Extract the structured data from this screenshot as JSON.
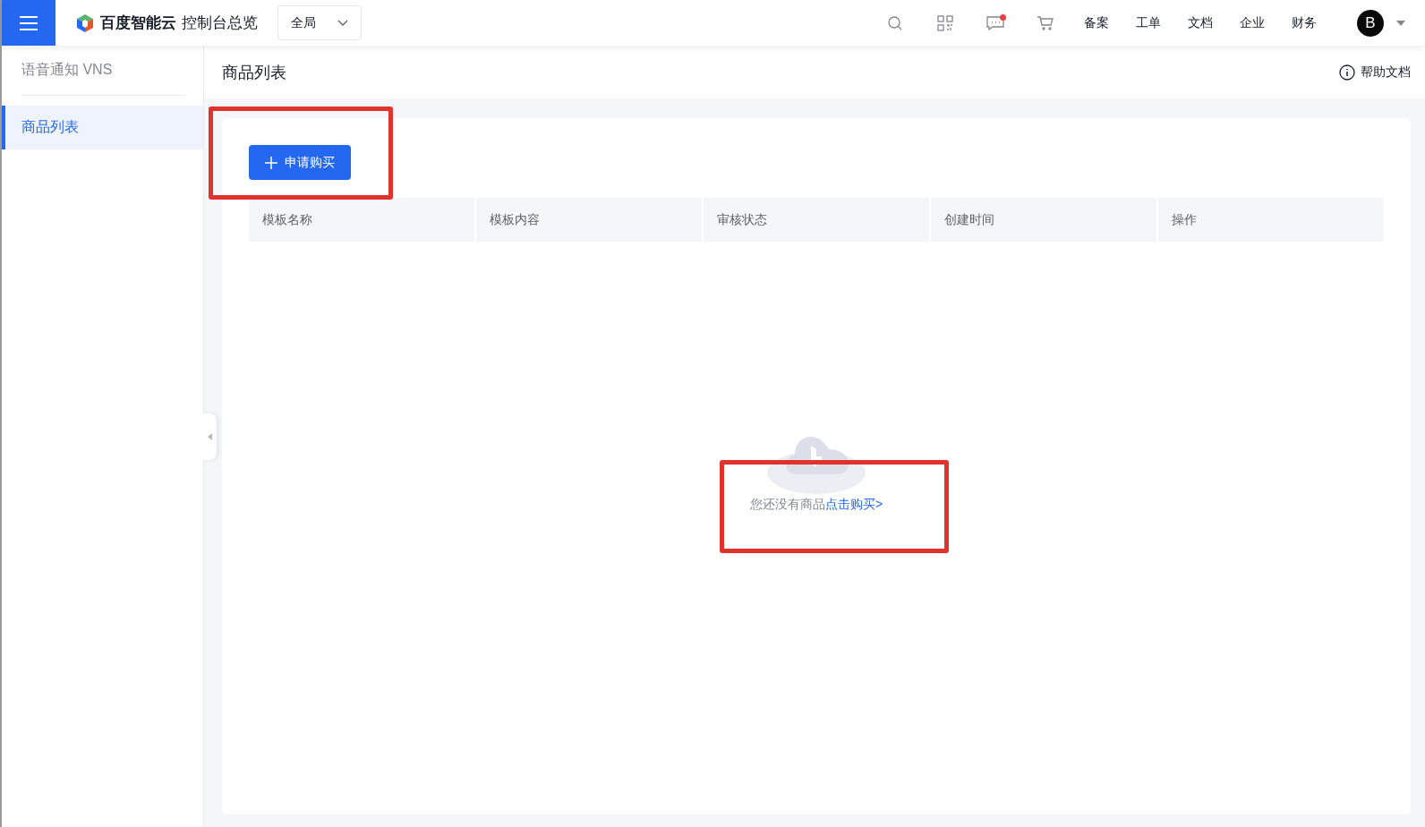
{
  "topbar": {
    "brand": "百度智能云",
    "console": "控制台总览",
    "region": "全局",
    "icons": [
      {
        "kind": "search",
        "badge": false
      },
      {
        "kind": "qrcode",
        "badge": false
      },
      {
        "kind": "message",
        "badge": true
      },
      {
        "kind": "cart",
        "badge": false
      }
    ],
    "links": [
      "备案",
      "工单",
      "文档",
      "企业",
      "财务"
    ],
    "avatar": "B"
  },
  "sidebar": {
    "title": "语音通知 VNS",
    "items": [
      {
        "label": "商品列表",
        "selected": true
      }
    ]
  },
  "page": {
    "title": "商品列表",
    "help": "帮助文档"
  },
  "toolbar": {
    "button": "申请购买",
    "highlighted": true
  },
  "table": {
    "columns": [
      "模板名称",
      "模板内容",
      "审核状态",
      "创建时间",
      "操作"
    ]
  },
  "empty": {
    "message": "您还没有商品",
    "link": "点击购买>",
    "highlighted": true
  }
}
